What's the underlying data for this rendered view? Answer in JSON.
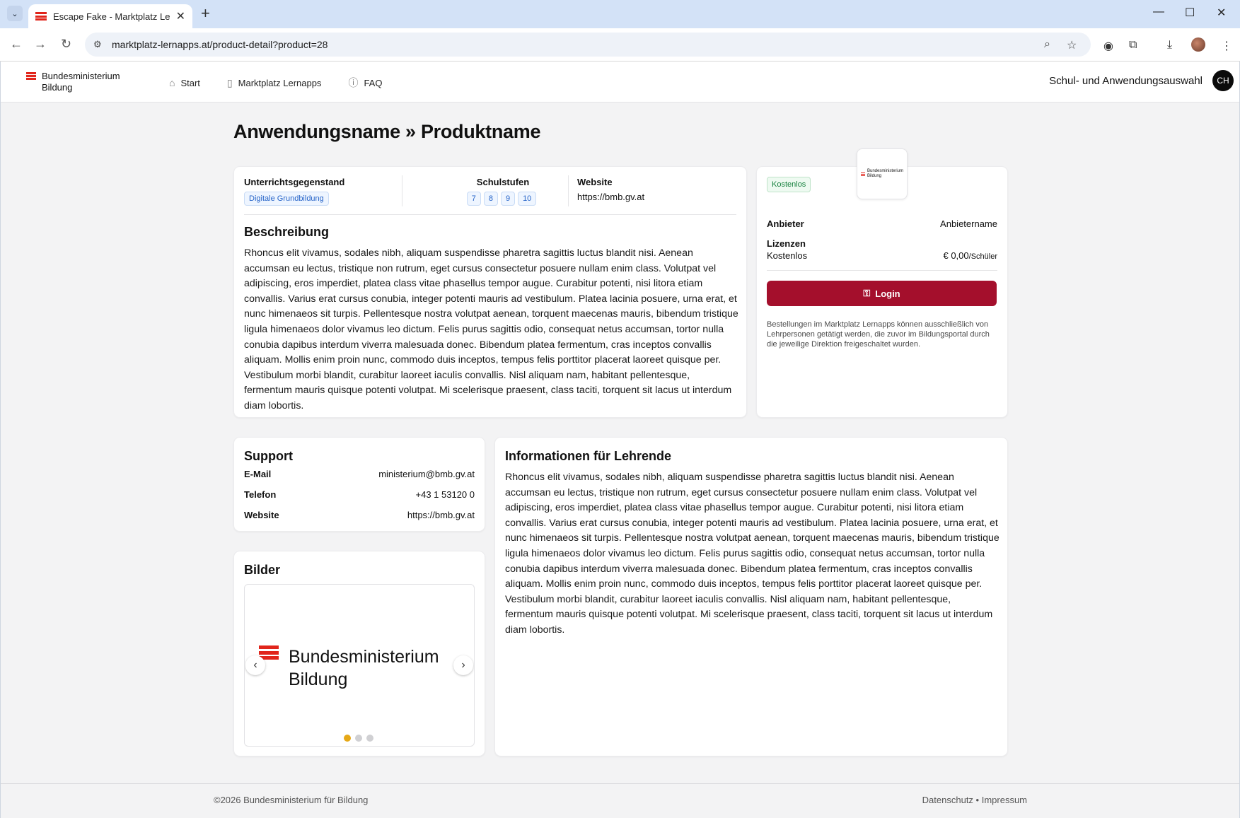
{
  "browser": {
    "tab_title": "Escape Fake - Marktplatz Lernap",
    "url": "marktplatz-lernapps.at/product-detail?product=28"
  },
  "header": {
    "logo_line1": "Bundesministerium",
    "logo_line2": "Bildung",
    "nav": [
      {
        "label": "Start",
        "icon": "home-icon"
      },
      {
        "label": "Marktplatz Lernapps",
        "icon": "phone-icon"
      },
      {
        "label": "FAQ",
        "icon": "help-icon"
      }
    ],
    "school_select_label": "Schul- und Anwendungsauswahl",
    "avatar_initials": "CH"
  },
  "product": {
    "title": "Anwendungsname » Produktname",
    "subject_label": "Unterrichtsgegenstand",
    "subject_value": "Digitale Grundbildung",
    "levels_label": "Schulstufen",
    "levels": [
      "7",
      "8",
      "9",
      "10"
    ],
    "website_label": "Website",
    "website_value": "https://bmb.gv.at",
    "description_title": "Beschreibung",
    "description": "Rhoncus elit vivamus, sodales nibh, aliquam suspendisse pharetra sagittis luctus blandit nisi. Aenean accumsan eu lectus, tristique non rutrum, eget cursus consectetur posuere nullam enim class. Volutpat vel adipiscing, eros imperdiet, platea class vitae phasellus tempor augue. Curabitur potenti, nisi litora etiam convallis. Varius erat cursus conubia, integer potenti mauris ad vestibulum. Platea lacinia posuere, urna erat, et nunc himenaeos sit turpis. Pellentesque nostra volutpat aenean, torquent maecenas mauris, bibendum tristique ligula himenaeos dolor vivamus leo dictum. Felis purus sagittis odio, consequat netus accumsan, tortor nulla conubia dapibus interdum viverra malesuada donec. Bibendum platea fermentum, cras inceptos convallis aliquam. Mollis enim proin nunc, commodo duis inceptos, tempus felis porttitor placerat laoreet quisque per. Vestibulum morbi blandit, curabitur laoreet iaculis convallis. Nisl aliquam nam, habitant pellentesque, fermentum mauris quisque potenti volutpat. Mi scelerisque praesent, class taciti, torquent sit lacus ut interdum diam lobortis."
  },
  "order": {
    "badge": "Kostenlos",
    "logo_line1": "Bundesministerium",
    "logo_line2": "Bildung",
    "provider_label": "Anbieter",
    "provider_value": "Anbietername",
    "licenses_label": "Lizenzen",
    "license_name": "Kostenlos",
    "license_price": "€ 0,00",
    "license_unit": "/Schüler",
    "login_label": "Login",
    "note": "Bestellungen im Marktplatz Lernapps können ausschließlich von Lehrpersonen getätigt werden, die zuvor im Bildungsportal durch die jeweilige Direktion freigeschaltet wurden."
  },
  "support": {
    "title": "Support",
    "email_label": "E-Mail",
    "email_value": "ministerium@bmb.gv.at",
    "phone_label": "Telefon",
    "phone_value": "+43 1 53120 0",
    "website_label": "Website",
    "website_value": "https://bmb.gv.at"
  },
  "images": {
    "title": "Bilder",
    "slide_line1": "Bundesministerium",
    "slide_line2": "Bildung",
    "slide_count": 3,
    "active_slide": 1
  },
  "teachers": {
    "title": "Informationen für Lehrende",
    "text": "Rhoncus elit vivamus, sodales nibh, aliquam suspendisse pharetra sagittis luctus blandit nisi. Aenean accumsan eu lectus, tristique non rutrum, eget cursus consectetur posuere nullam enim class. Volutpat vel adipiscing, eros imperdiet, platea class vitae phasellus tempor augue. Curabitur potenti, nisi litora etiam convallis. Varius erat cursus conubia, integer potenti mauris ad vestibulum. Platea lacinia posuere, urna erat, et nunc himenaeos sit turpis. Pellentesque nostra volutpat aenean, torquent maecenas mauris, bibendum tristique ligula himenaeos dolor vivamus leo dictum. Felis purus sagittis odio, consequat netus accumsan, tortor nulla conubia dapibus interdum viverra malesuada donec. Bibendum platea fermentum, cras inceptos convallis aliquam. Mollis enim proin nunc, commodo duis inceptos, tempus felis porttitor placerat laoreet quisque per. Vestibulum morbi blandit, curabitur laoreet iaculis convallis. Nisl aliquam nam, habitant pellentesque, fermentum mauris quisque potenti volutpat. Mi scelerisque praesent, class taciti, torquent sit lacus ut interdum diam lobortis."
  },
  "footer": {
    "copyright": "©2026 Bundesministerium für Bildung",
    "links": "Datenschutz • Impressum"
  },
  "colors": {
    "accent": "#a40f2c",
    "flag_red": "#e1251b",
    "badge_green": "#15803d",
    "chip_blue": "#2563c8",
    "carousel_dot_active": "#e6a817"
  }
}
